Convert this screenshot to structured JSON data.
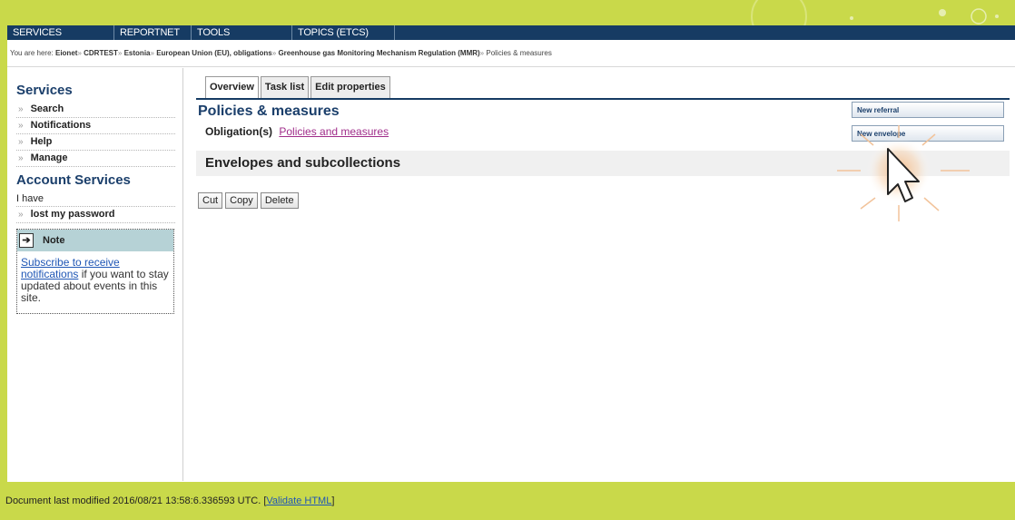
{
  "nav": {
    "items": [
      "SERVICES",
      "REPORTNET",
      "TOOLS",
      "TOPICS (ETCS)"
    ]
  },
  "breadcrumb": {
    "prefix": "You are here:",
    "items": [
      "Eionet",
      "CDRTEST",
      "Estonia",
      "European Union (EU), obligations",
      "Greenhouse gas Monitoring Mechanism Regulation (MMR)",
      "Policies & measures"
    ]
  },
  "sidebar": {
    "services_title": "Services",
    "services": [
      "Search",
      "Notifications",
      "Help",
      "Manage"
    ],
    "account_title": "Account Services",
    "i_have": "I have",
    "lost_password": "lost my password",
    "note": {
      "title": "Note",
      "link_text": "Subscribe to receive notifications",
      "body_text": " if you want to stay updated about events in this site."
    }
  },
  "main": {
    "tabs": [
      "Overview",
      "Task list",
      "Edit properties"
    ],
    "active_tab": "Overview",
    "title": "Policies & measures",
    "obligation_label": "Obligation(s)",
    "obligation_link": "Policies and measures",
    "new_referral": "New referral",
    "new_envelope": "New envelope",
    "envelopes_heading": "Envelopes and subcollections",
    "buttons": [
      "Cut",
      "Copy",
      "Delete"
    ]
  },
  "footer": {
    "text": "Document last modified 2016/08/21 13:58:6.336593 UTC. [",
    "validate_link": "Validate HTML",
    "close": "]"
  },
  "colors": {
    "lime": "#c9d94a",
    "navy": "#163b63",
    "title_blue": "#1b3f6b",
    "link_purple": "#a02d8a"
  },
  "icons": [
    "arrow-right-icon",
    "mouse-pointer-icon"
  ]
}
